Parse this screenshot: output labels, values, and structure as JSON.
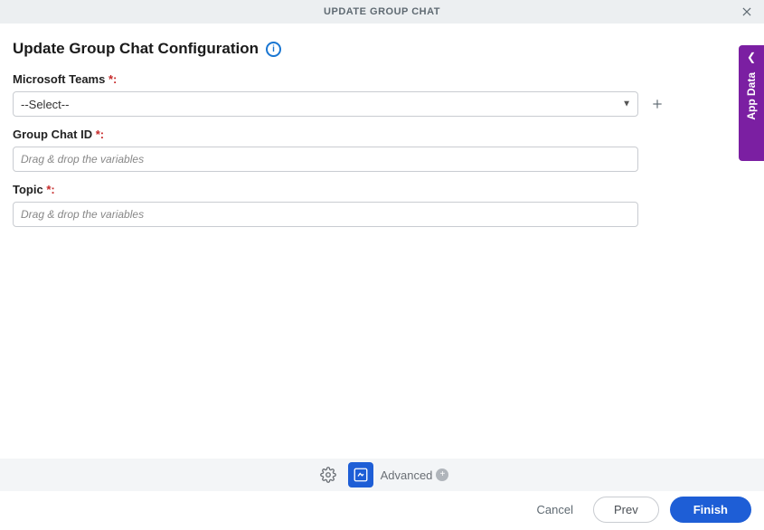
{
  "header": {
    "title": "UPDATE GROUP CHAT"
  },
  "page": {
    "heading": "Update Group Chat Configuration"
  },
  "form": {
    "microsoft_teams": {
      "label": "Microsoft Teams",
      "required_colon": " *:",
      "selected": "--Select--"
    },
    "group_chat_id": {
      "label": "Group Chat ID",
      "required_colon": " *:",
      "placeholder": "Drag & drop the variables"
    },
    "topic": {
      "label": "Topic",
      "required_colon": " *:",
      "placeholder": "Drag & drop the variables"
    }
  },
  "side_panel": {
    "label": "App Data"
  },
  "toolbar": {
    "advanced_label": "Advanced"
  },
  "footer": {
    "cancel": "Cancel",
    "prev": "Prev",
    "finish": "Finish"
  }
}
